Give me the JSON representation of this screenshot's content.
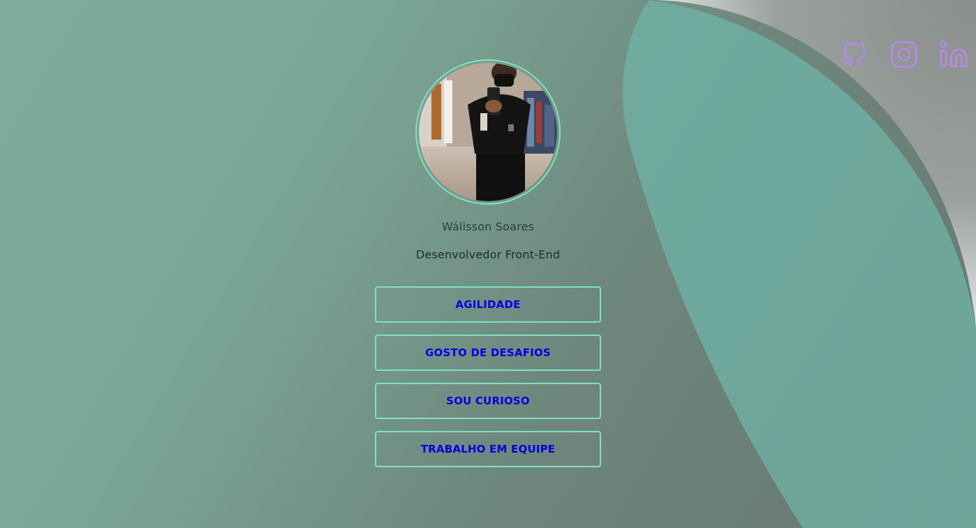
{
  "profile": {
    "name": "Wálisson Soares",
    "role": "Desenvolvedor Front-End",
    "avatar_alt": "avatar"
  },
  "skills": [
    {
      "label": "AGILIDADE"
    },
    {
      "label": "GOSTO DE DESAFIOS"
    },
    {
      "label": "SOU CURIOSO"
    },
    {
      "label": "TRABALHO EM EQUIPE"
    }
  ],
  "social": [
    {
      "icon": "github-icon",
      "label": "GitHub"
    },
    {
      "icon": "instagram-icon",
      "label": "Instagram"
    },
    {
      "icon": "linkedin-icon",
      "label": "LinkedIn"
    }
  ],
  "colors": {
    "accent_border": "#7de3bf",
    "button_text": "#0000e0",
    "icon_color": "#b58ae0"
  }
}
